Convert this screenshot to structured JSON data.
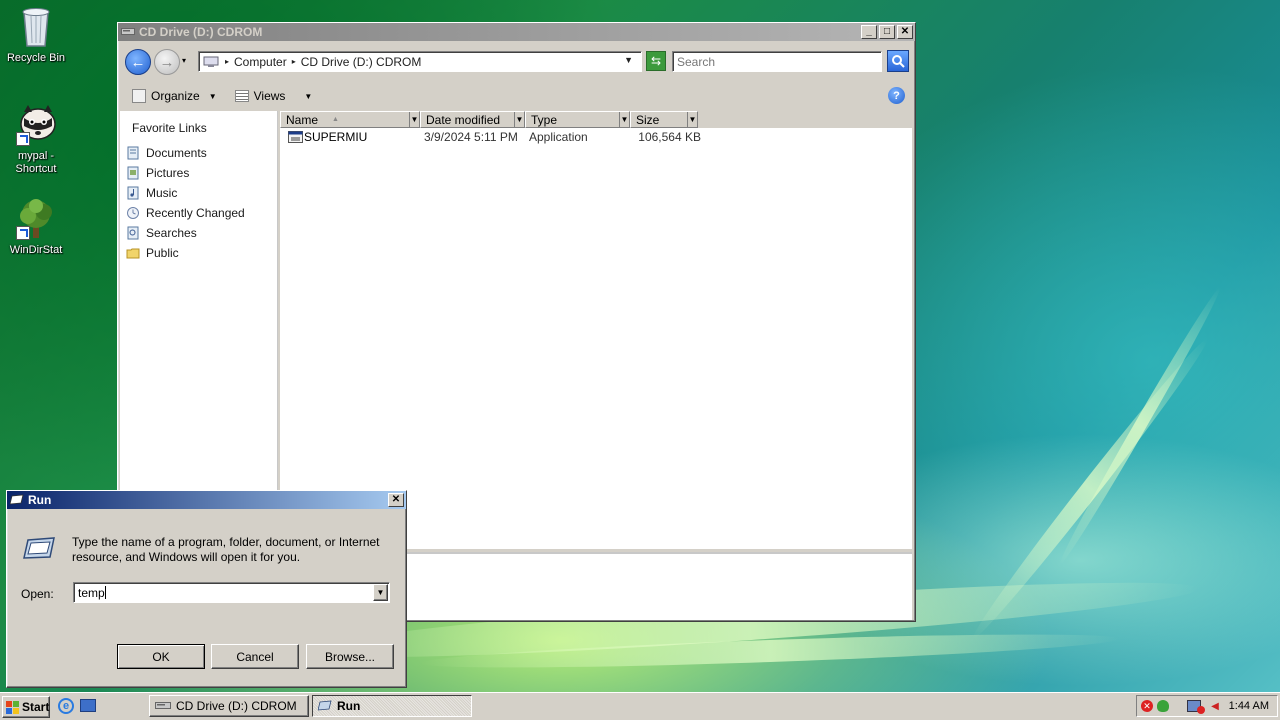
{
  "desktop": {
    "icons": [
      {
        "label": "Recycle Bin"
      },
      {
        "label": "mypal - Shortcut"
      },
      {
        "label": "WinDirStat"
      }
    ]
  },
  "explorer": {
    "title": "CD Drive (D:) CDROM",
    "breadcrumb": [
      "Computer",
      "CD Drive (D:) CDROM"
    ],
    "search_placeholder": "Search",
    "toolbar": {
      "organize": "Organize",
      "views": "Views"
    },
    "favorite_links_title": "Favorite Links",
    "favorite_links": [
      "Documents",
      "Pictures",
      "Music",
      "Recently Changed",
      "Searches",
      "Public"
    ],
    "columns": [
      "Name",
      "Date modified",
      "Type",
      "Size"
    ],
    "files": [
      {
        "name": "SUPERMIU",
        "date_modified": "3/9/2024 5:11 PM",
        "type": "Application",
        "size": "106,564 KB"
      }
    ]
  },
  "run_dialog": {
    "title": "Run",
    "description": "Type the name of a program, folder, document, or Internet resource, and Windows will open it for you.",
    "open_label": "Open:",
    "open_value": "temp",
    "ok_label": "OK",
    "cancel_label": "Cancel",
    "browse_label": "Browse..."
  },
  "taskbar": {
    "start_label": "Start",
    "tasks": [
      {
        "label": "CD Drive (D:) CDROM",
        "active": false
      },
      {
        "label": "Run",
        "active": true
      }
    ],
    "clock": "1:44 AM"
  },
  "colors": {
    "active_title_start": "#0a246a",
    "active_title_end": "#a6caf0",
    "inactive_title": "#808080",
    "face": "#d4d0c8"
  }
}
